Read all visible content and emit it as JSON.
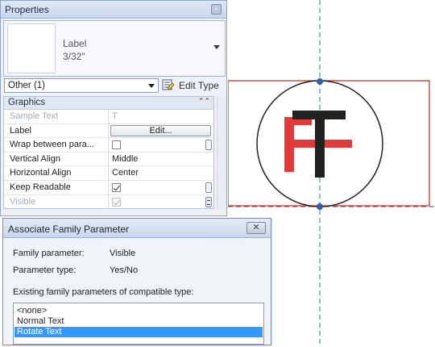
{
  "properties": {
    "title": "Properties",
    "close_glyph": "×",
    "type": {
      "family": "Label",
      "size": "3/32\""
    },
    "filter": "Other (1)",
    "edit_type_label": "Edit Type",
    "group": {
      "label": "Graphics",
      "collapse_glyph": "⌃⌃"
    },
    "rows": {
      "sample_text": {
        "name": "Sample Text",
        "value": "T"
      },
      "label": {
        "name": "Label",
        "button": "Edit..."
      },
      "wrap": {
        "name": "Wrap between para..."
      },
      "vertical_align": {
        "name": "Vertical Align",
        "value": "Middle"
      },
      "horizontal_align": {
        "name": "Horizontal Align",
        "value": "Center"
      },
      "keep_readable": {
        "name": "Keep Readable",
        "checked": true
      },
      "visible": {
        "name": "Visible",
        "checked": true
      }
    }
  },
  "dialog": {
    "title": "Associate Family Parameter",
    "close_glyph": "✕",
    "family_parameter_label": "Family parameter:",
    "family_parameter_value": "Visible",
    "parameter_type_label": "Parameter type:",
    "parameter_type_value": "Yes/No",
    "compatible_caption": "Existing family parameters of compatible type:",
    "items": [
      "<none>",
      "Normal Text",
      "Rotate Text"
    ],
    "selected_item": "Rotate Text"
  },
  "colors": {
    "selection_highlight": "#3399ff",
    "reference_line": "#3a9a9a",
    "label_box": "#d9302a",
    "glyph_red": "#e23a3a",
    "glyph_black": "#222222",
    "grip": "#2f5fa8"
  },
  "icons": [
    "close-icon",
    "dropdown-arrow-icon",
    "edit-type-icon",
    "checkbox-icon",
    "associate-parameter-icon"
  ]
}
